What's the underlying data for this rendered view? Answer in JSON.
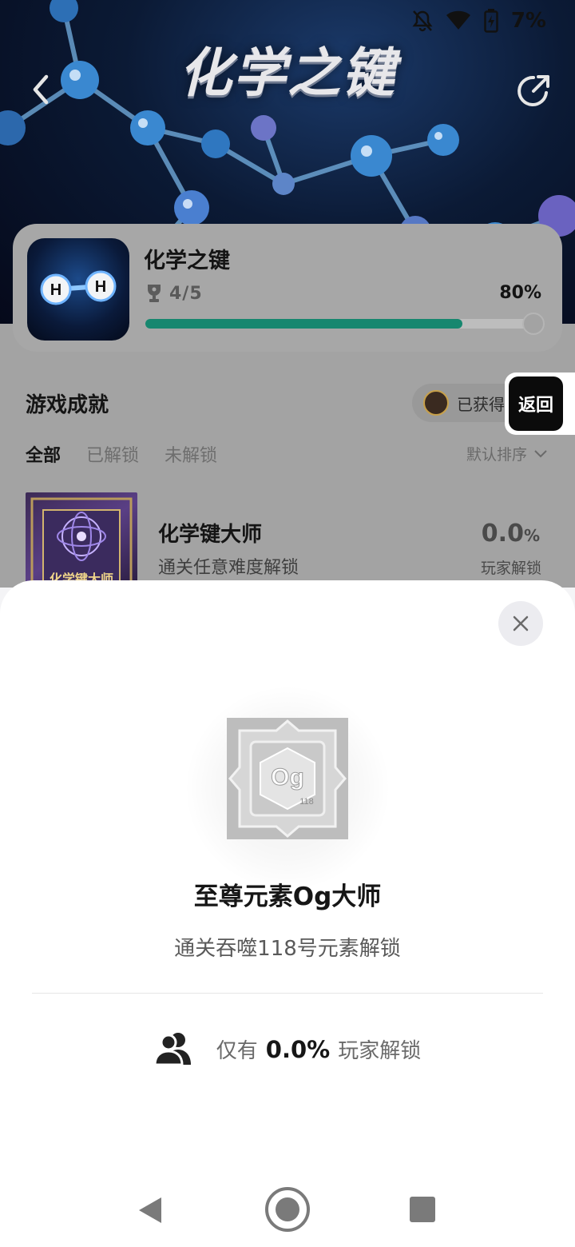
{
  "status_bar": {
    "battery_percent": "7%",
    "icons": [
      "mute-icon",
      "wifi-icon",
      "battery-charging-icon"
    ]
  },
  "banner": {
    "title": "化学之键",
    "icons": {
      "back": "chevron-left-icon",
      "share": "share-icon"
    }
  },
  "game": {
    "name": "化学之键",
    "trophy_icon": "trophy-icon",
    "trophies": "4/5",
    "progress_percent": "80%",
    "progress_value": 0.8,
    "icon_letters": [
      "H",
      "H"
    ],
    "accent_color": "#17876f"
  },
  "achievements_section": {
    "title": "游戏成就",
    "earned_label": "已获得",
    "return_button": "返回",
    "tabs": [
      {
        "label": "全部",
        "active": true
      },
      {
        "label": "已解锁",
        "active": false
      },
      {
        "label": "未解锁",
        "active": false
      }
    ],
    "sort_label": "默认排序",
    "items": [
      {
        "name": "化学键大师",
        "description": "通关任意难度解锁",
        "percent_number": "0.0",
        "percent_unit": "%",
        "percent_label": "玩家解锁",
        "thumb_caption": "化学键大师"
      }
    ]
  },
  "sheet": {
    "badge_symbol": "Og",
    "badge_number": "118",
    "title": "至尊元素Og大师",
    "description": "通关吞噬118号元素解锁",
    "unlock_prefix": "仅有",
    "unlock_percent": "0.0%",
    "unlock_suffix": "玩家解锁",
    "icons": {
      "close": "close-icon",
      "players": "users-icon"
    }
  },
  "navbar": {
    "icons": [
      "nav-back-icon",
      "nav-home-icon",
      "nav-recent-icon"
    ]
  }
}
